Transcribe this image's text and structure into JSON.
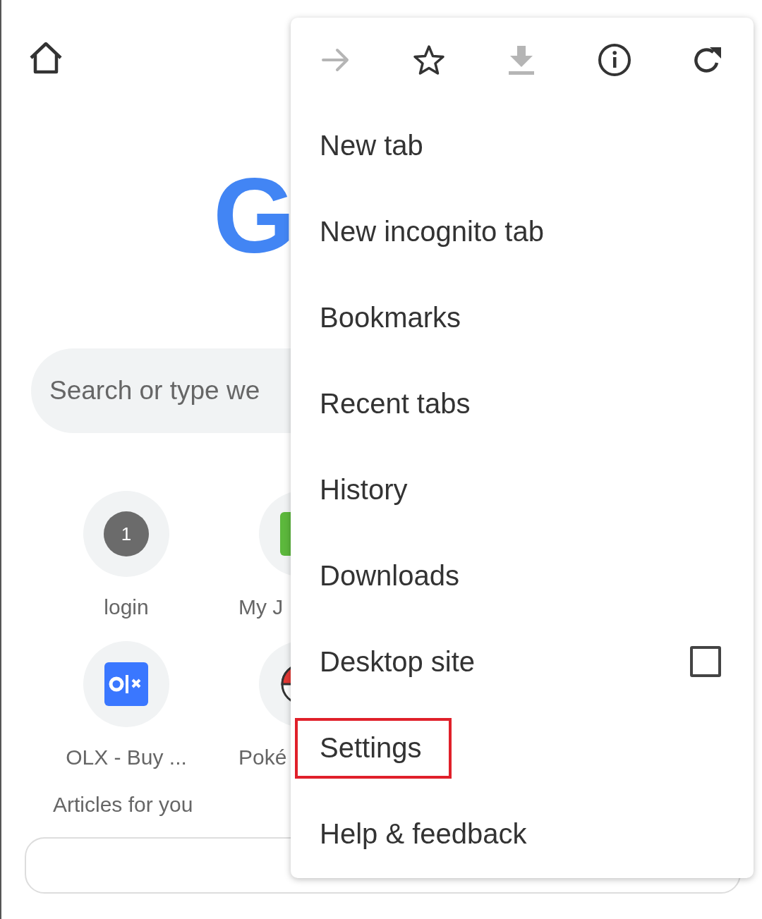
{
  "page": {
    "logo": "G",
    "search": {
      "placeholder": "Search or type we"
    },
    "tiles": [
      {
        "kind": "badge",
        "badge": "1",
        "label": "login"
      },
      {
        "kind": "green",
        "label": "My J"
      },
      {
        "kind": "olx",
        "label": "OLX - Buy ..."
      },
      {
        "kind": "ball",
        "label": "Poké"
      }
    ],
    "section_title": "Articles for you"
  },
  "menu": {
    "toolbar": [
      {
        "kind": "forward",
        "disabled": true
      },
      {
        "kind": "star",
        "disabled": false
      },
      {
        "kind": "download",
        "disabled": true
      },
      {
        "kind": "info",
        "disabled": false
      },
      {
        "kind": "reload",
        "disabled": false
      }
    ],
    "items": [
      {
        "label": "New tab",
        "highlighted": false
      },
      {
        "label": "New incognito tab",
        "highlighted": false
      },
      {
        "label": "Bookmarks",
        "highlighted": false
      },
      {
        "label": "Recent tabs",
        "highlighted": false
      },
      {
        "label": "History",
        "highlighted": false
      },
      {
        "label": "Downloads",
        "highlighted": false
      },
      {
        "label": "Desktop site",
        "kind": "checkbox",
        "checked": false,
        "highlighted": false
      },
      {
        "label": "Settings",
        "highlighted": true
      },
      {
        "label": "Help & feedback",
        "highlighted": false
      }
    ]
  }
}
